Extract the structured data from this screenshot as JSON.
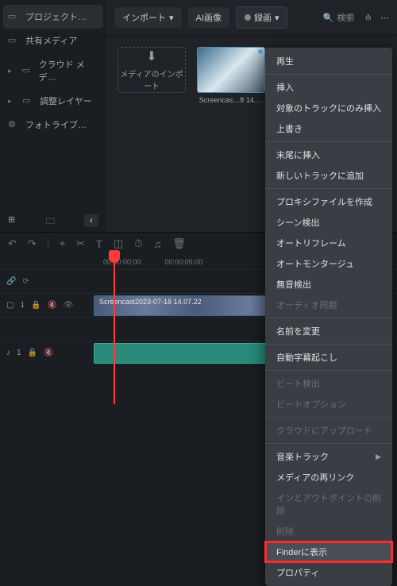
{
  "sidebar": {
    "items": [
      {
        "label": "プロジェクト…",
        "icon": "folder",
        "expandable": false,
        "active": true
      },
      {
        "label": "共有メディア",
        "icon": "folder",
        "expandable": false
      },
      {
        "label": "クラウド メデ…",
        "icon": "cloud",
        "expandable": true
      },
      {
        "label": "調整レイヤー",
        "icon": "folder",
        "expandable": true
      },
      {
        "label": "フォトライブ…",
        "icon": "gear",
        "expandable": false
      }
    ]
  },
  "toolbar": {
    "import": "インポート",
    "ai_image": "AI画像",
    "record": "録画",
    "search_placeholder": "検索"
  },
  "media": {
    "import_drop": "メディアのインポート",
    "thumb_label": "Screencas…8 14.…"
  },
  "timeline": {
    "ruler": [
      "",
      "00:00:00:00",
      "00:00:05:00"
    ],
    "clip_label": "Screencast2023-07-18 14.07.22",
    "track_video": "1",
    "track_audio": "1"
  },
  "ctx": {
    "items": [
      {
        "label": "再生",
        "sep_after": true
      },
      {
        "label": "挿入"
      },
      {
        "label": "対象のトラックにのみ挿入"
      },
      {
        "label": "上書き",
        "sep_after": true
      },
      {
        "label": "末尾に挿入"
      },
      {
        "label": "新しいトラックに追加",
        "sep_after": true
      },
      {
        "label": "プロキシファイルを作成"
      },
      {
        "label": "シーン検出"
      },
      {
        "label": "オートリフレーム"
      },
      {
        "label": "オートモンタージュ"
      },
      {
        "label": "無音検出"
      },
      {
        "label": "オーディオ同期",
        "disabled": true,
        "sep_after": true
      },
      {
        "label": "名前を変更",
        "sep_after": true
      },
      {
        "label": "自動字幕起こし",
        "sep_after": true
      },
      {
        "label": "ビート検出",
        "disabled": true
      },
      {
        "label": "ビートオプション",
        "disabled": true,
        "sep_after": true
      },
      {
        "label": "クラウドにアップロード",
        "disabled": true,
        "sep_after": true
      },
      {
        "label": "音楽トラック",
        "submenu": true
      },
      {
        "label": "メディアの再リンク"
      },
      {
        "label": "インとアウトポイントの削除",
        "disabled": true
      },
      {
        "label": "削除",
        "disabled": true
      },
      {
        "label": "Finderに表示",
        "highlight": true
      },
      {
        "label": "プロパティ"
      }
    ]
  }
}
